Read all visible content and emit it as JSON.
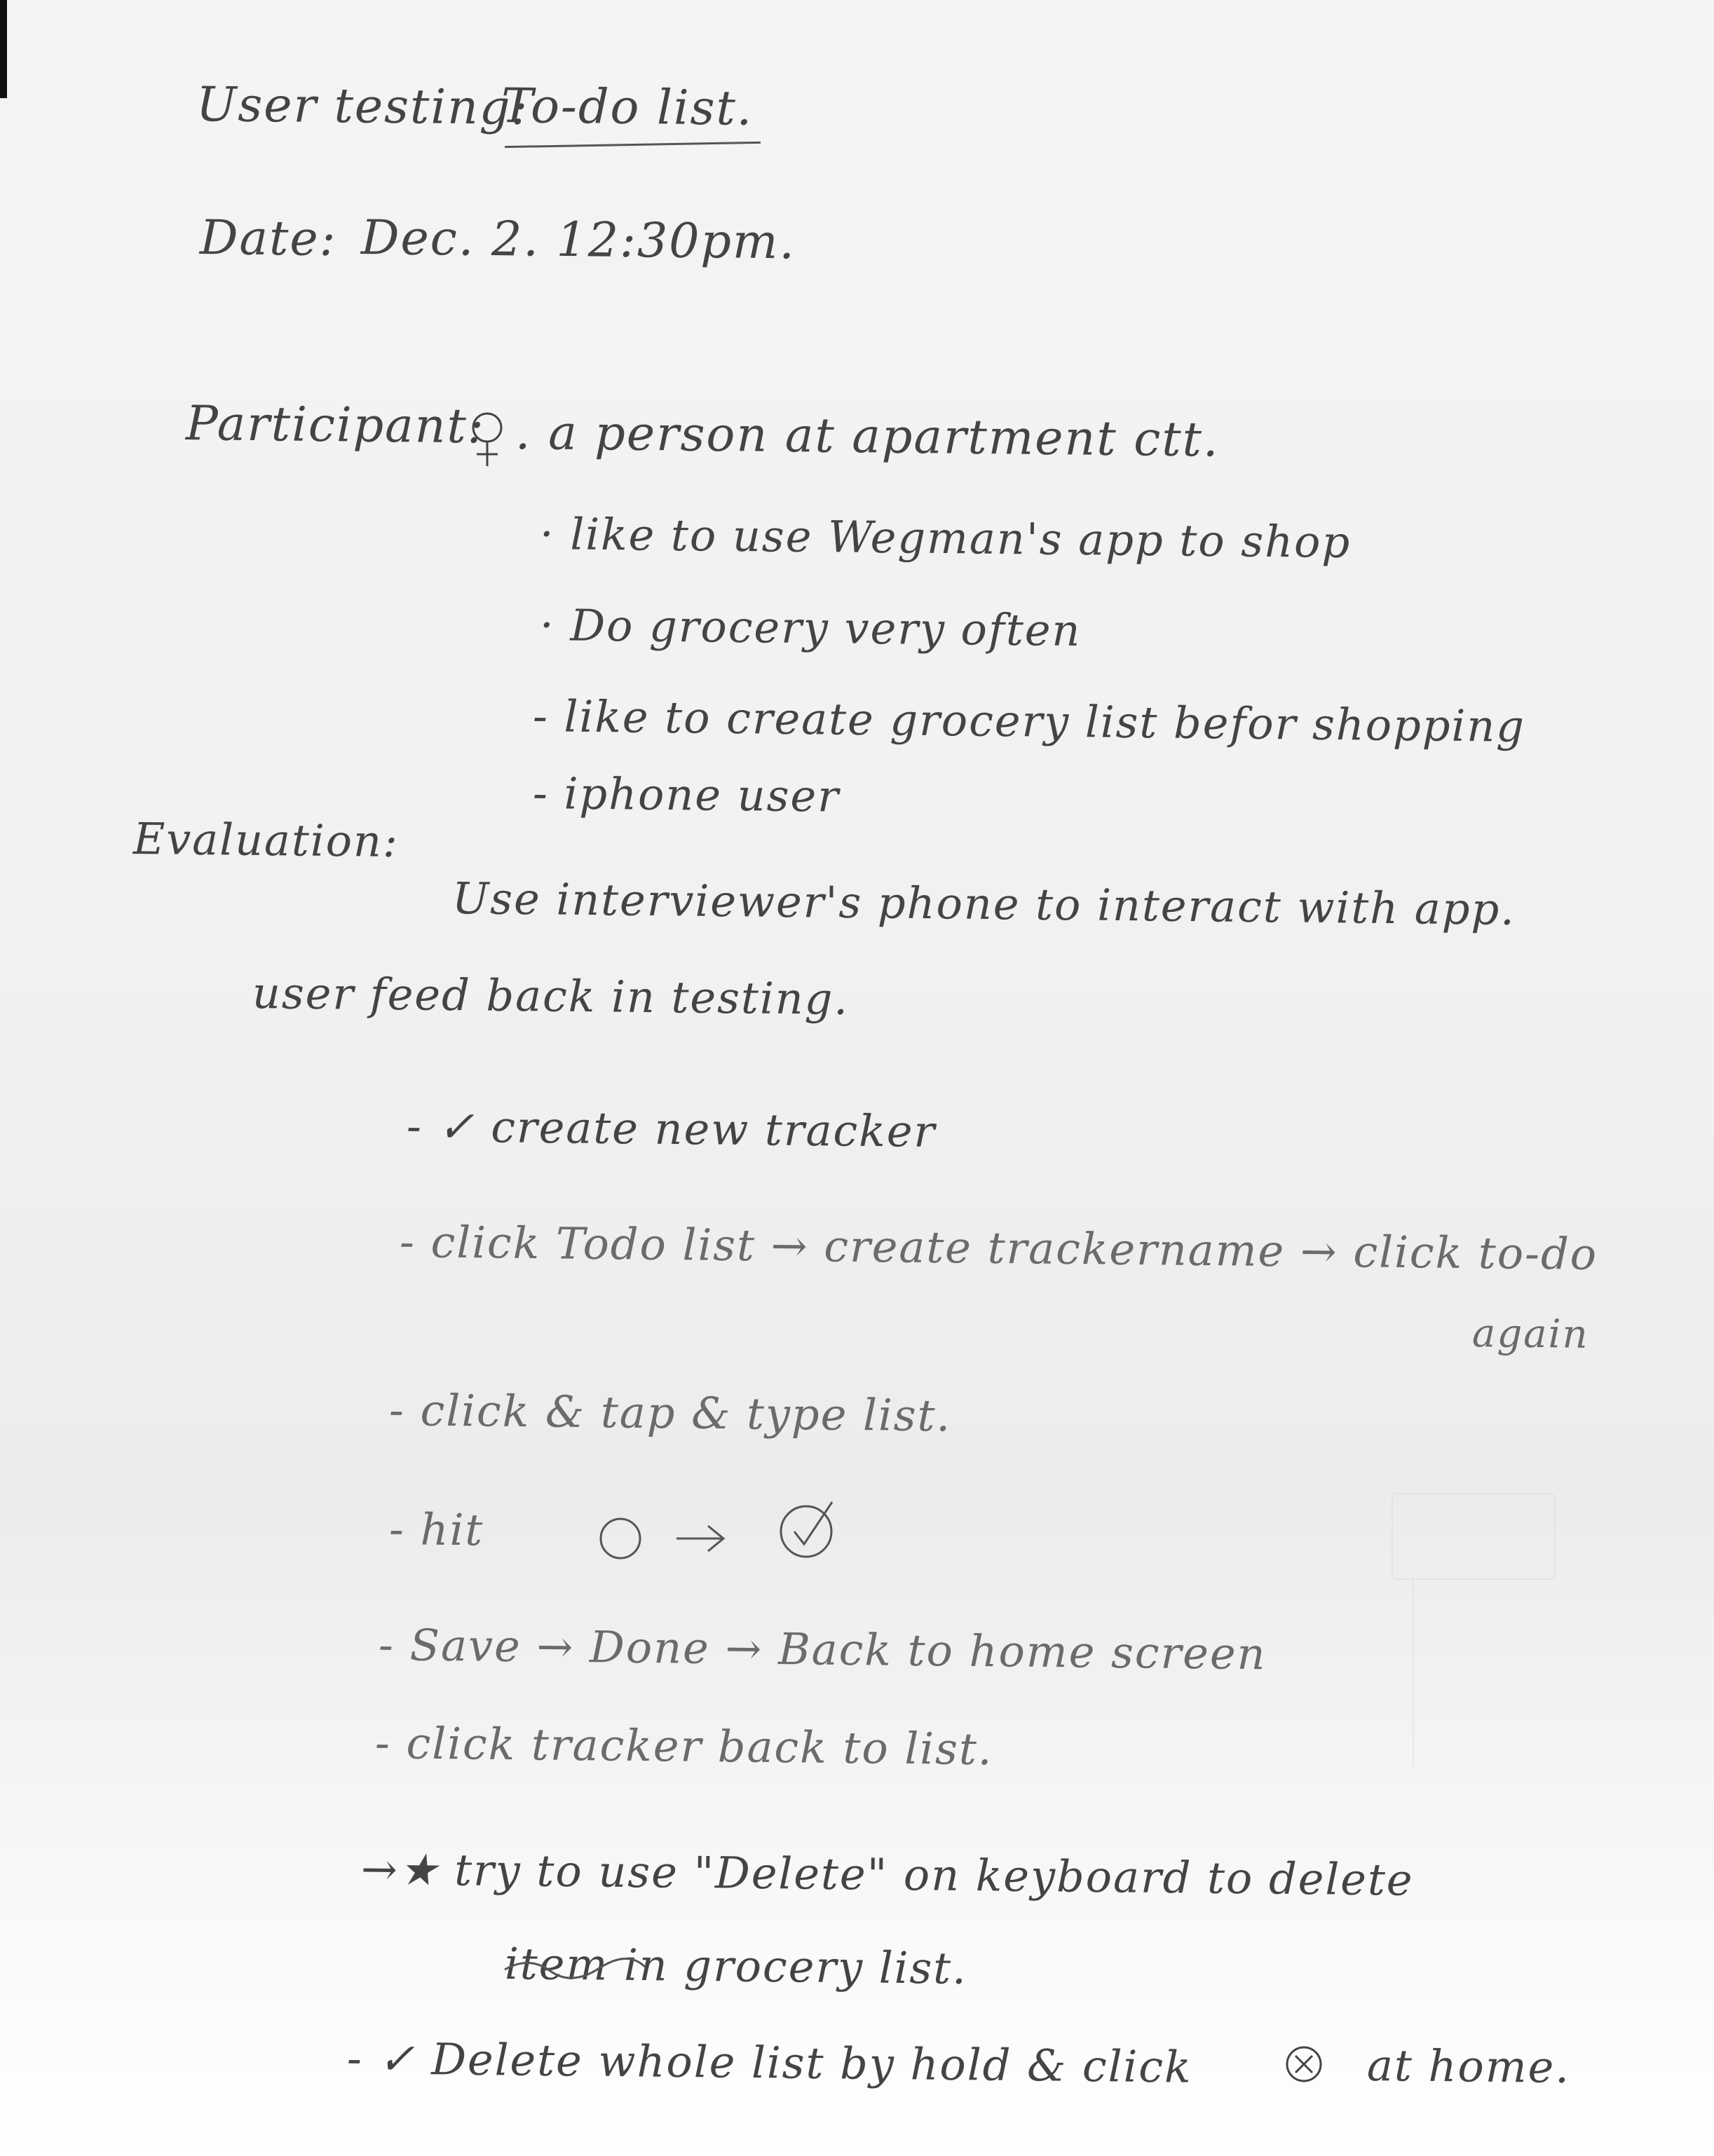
{
  "heading": {
    "label": "User testing:",
    "title": "To-do list."
  },
  "date": {
    "label": "Date:",
    "value": "Dec. 2. 12:30pm."
  },
  "participant": {
    "label": "Participant:",
    "description": ". a person at apartment ctt.",
    "traits": [
      "· like to use Wegman's app to shop",
      "· Do grocery very often",
      "- like to create grocery list befor shopping",
      "- iphone user"
    ]
  },
  "evaluation": {
    "label": "Evaluation:",
    "text": "Use interviewer's phone to interact with app."
  },
  "feedback": {
    "heading": "user feed back in testing.",
    "items": [
      "- ✓ create new tracker",
      "- click Todo list → create trackername → click to-do",
      "again",
      "- click & tap & type list.",
      "- hit",
      "- Save → Done → Back to home screen",
      "- click tracker back to list.",
      "→★ try to use \"Delete\" on keyboard to delete",
      "item in grocery list.",
      "- ✓ Delete whole list by hold & click",
      "at home."
    ]
  },
  "icons": {
    "female": "female-symbol-icon",
    "empty_circle": "empty-circle-icon",
    "checked_circle": "checked-circle-icon",
    "x_circle": "x-circle-icon",
    "star": "star-icon",
    "strikethrough_word": "scribbled-word"
  }
}
